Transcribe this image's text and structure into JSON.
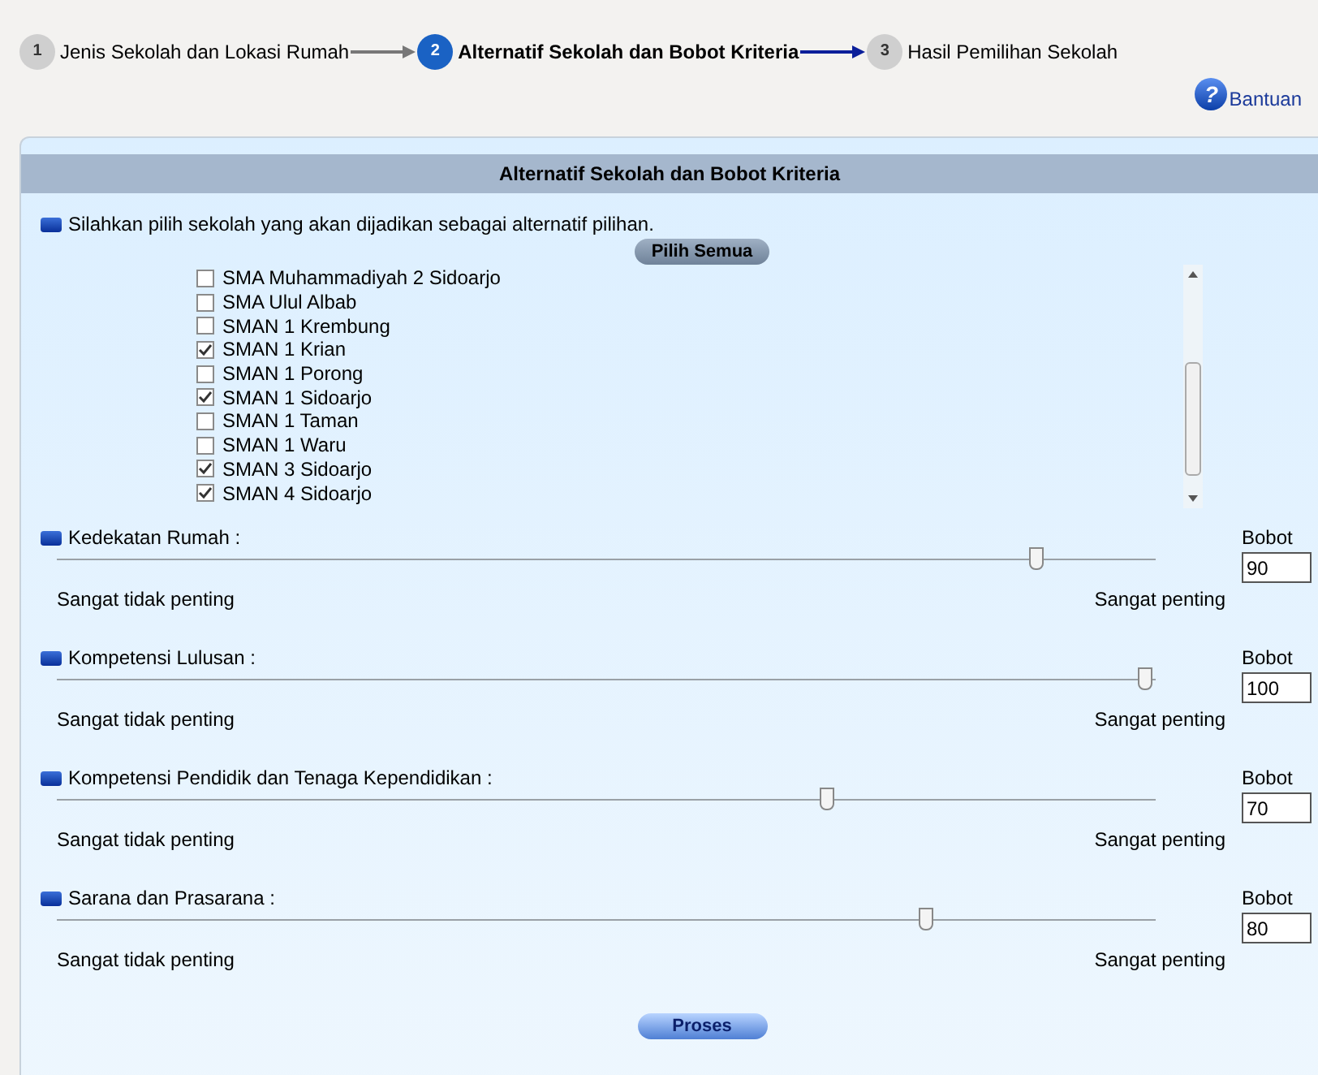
{
  "steps": [
    {
      "number": "1",
      "label": "Jenis Sekolah dan Lokasi Rumah",
      "selected": false
    },
    {
      "number": "2",
      "label": "Alternatif Sekolah dan Bobot Kriteria",
      "selected": true
    },
    {
      "number": "3",
      "label": "Hasil Pemilihan Sekolah",
      "selected": false
    }
  ],
  "help_icon": "?",
  "help_link": "Bantuan",
  "panel": {
    "title": "Alternatif Sekolah dan Bobot Kriteria",
    "instruction": "Silahkan pilih sekolah yang akan dijadikan sebagai alternatif pilihan.",
    "select_all_button": "Pilih Semua",
    "schools": [
      {
        "name": "SMA Muhammadiyah 2 Sidoarjo",
        "checked": false
      },
      {
        "name": "SMA Ulul Albab",
        "checked": false
      },
      {
        "name": "SMAN 1 Krembung",
        "checked": false
      },
      {
        "name": "SMAN 1 Krian",
        "checked": true
      },
      {
        "name": "SMAN 1 Porong",
        "checked": false
      },
      {
        "name": "SMAN 1 Sidoarjo",
        "checked": true
      },
      {
        "name": "SMAN 1 Taman",
        "checked": false
      },
      {
        "name": "SMAN 1 Waru",
        "checked": false
      },
      {
        "name": "SMAN 3 Sidoarjo",
        "checked": true
      },
      {
        "name": "SMAN 4 Sidoarjo",
        "checked": true
      }
    ],
    "criteria": [
      {
        "label": "Kedekatan Rumah :",
        "weight_label": "Bobot",
        "level": 0.89,
        "value": "90",
        "min_label": "Sangat tidak penting",
        "max_label": "Sangat penting"
      },
      {
        "label": "Kompetensi Lulusan :",
        "weight_label": "Bobot",
        "level": 0.99,
        "value": "100",
        "min_label": "Sangat tidak penting",
        "max_label": "Sangat penting"
      },
      {
        "label": "Kompetensi Pendidik dan Tenaga Kependidikan :",
        "weight_label": "Bobot",
        "level": 0.7,
        "value": "70",
        "min_label": "Sangat tidak penting",
        "max_label": "Sangat penting"
      },
      {
        "label": "Sarana dan Prasarana :",
        "weight_label": "Bobot",
        "level": 0.79,
        "value": "80",
        "min_label": "Sangat tidak penting",
        "max_label": "Sangat penting"
      }
    ],
    "submit_button": "Proses"
  }
}
